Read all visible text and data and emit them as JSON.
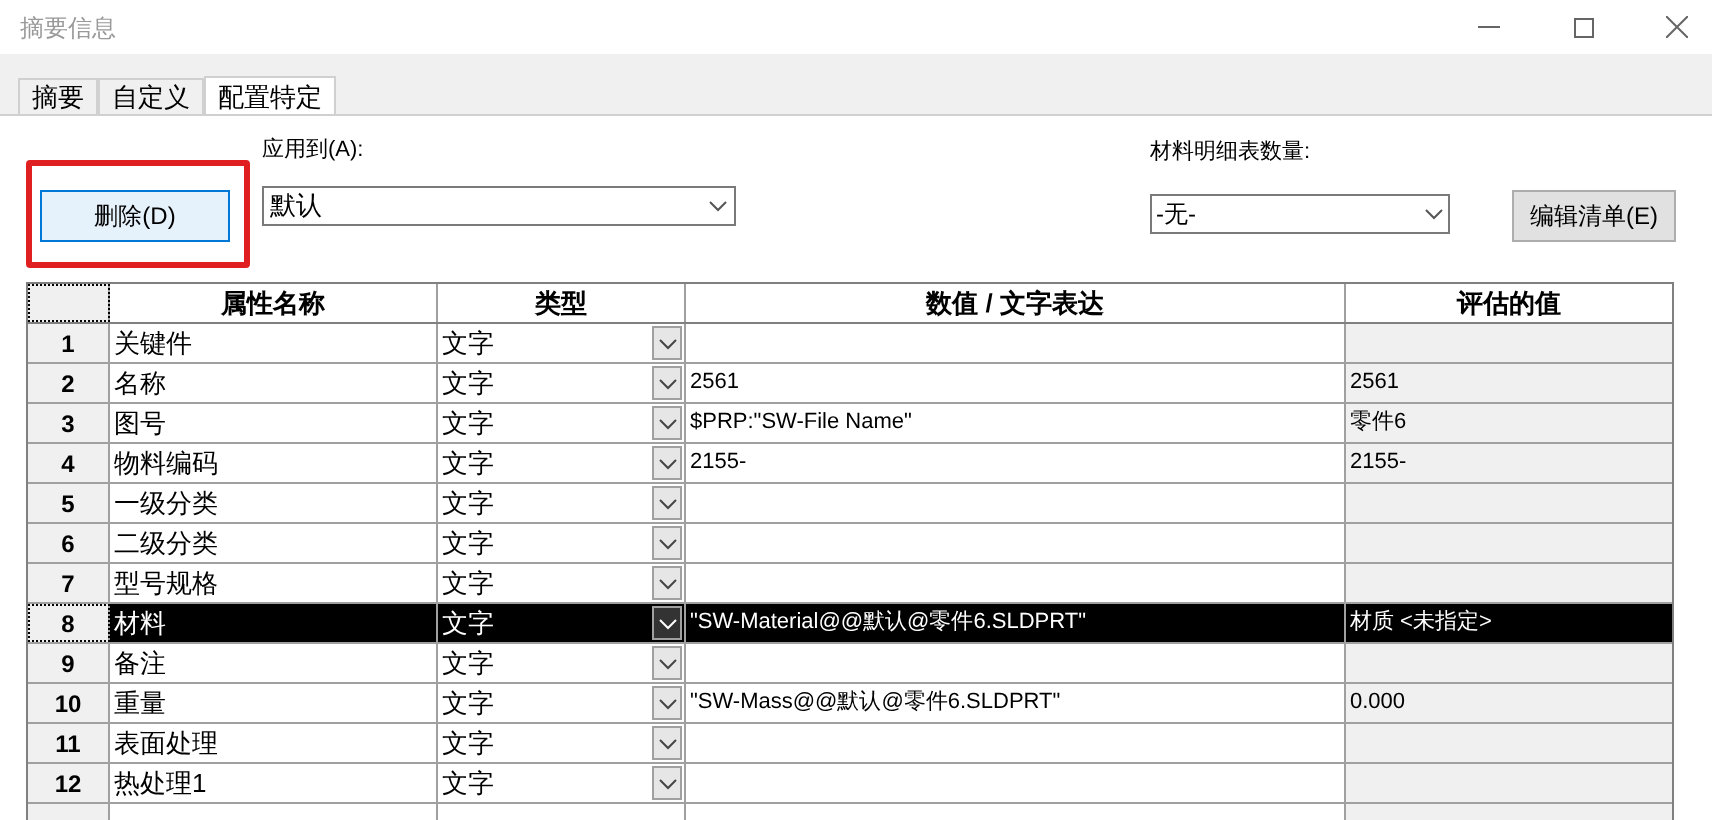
{
  "window": {
    "title": "摘要信息"
  },
  "tabs": [
    {
      "label": "摘要",
      "selected": false
    },
    {
      "label": "自定义",
      "selected": false
    },
    {
      "label": "配置特定",
      "selected": true
    }
  ],
  "delete_button": {
    "label": "删除(D)",
    "highlighted": true
  },
  "apply_to": {
    "label": "应用到(A):",
    "value": "默认"
  },
  "bom_quantity": {
    "label": "材料明细表数量:",
    "value": "-无-"
  },
  "edit_list_button": {
    "label": "编辑清单(E)"
  },
  "table": {
    "columns": [
      "属性名称",
      "类型",
      "数值 / 文字表达",
      "评估的值"
    ],
    "rows": [
      {
        "number": "1",
        "name": "关键件",
        "type": "文字",
        "value": "",
        "evaluated": "",
        "selected": false
      },
      {
        "number": "2",
        "name": "名称",
        "type": "文字",
        "value": "2561",
        "evaluated": "2561",
        "selected": false
      },
      {
        "number": "3",
        "name": "图号",
        "type": "文字",
        "value": "$PRP:\"SW-File Name\"",
        "evaluated": "零件6",
        "selected": false
      },
      {
        "number": "4",
        "name": "物料编码",
        "type": "文字",
        "value": "2155-",
        "evaluated": "2155-",
        "selected": false
      },
      {
        "number": "5",
        "name": "一级分类",
        "type": "文字",
        "value": "",
        "evaluated": "",
        "selected": false
      },
      {
        "number": "6",
        "name": "二级分类",
        "type": "文字",
        "value": "",
        "evaluated": "",
        "selected": false
      },
      {
        "number": "7",
        "name": "型号规格",
        "type": "文字",
        "value": "",
        "evaluated": "",
        "selected": false
      },
      {
        "number": "8",
        "name": "材料",
        "type": "文字",
        "value": "\"SW-Material@@默认@零件6.SLDPRT\"",
        "evaluated": "材质 <未指定>",
        "selected": true
      },
      {
        "number": "9",
        "name": "备注",
        "type": "文字",
        "value": "",
        "evaluated": "",
        "selected": false
      },
      {
        "number": "10",
        "name": "重量",
        "type": "文字",
        "value": "\"SW-Mass@@默认@零件6.SLDPRT\"",
        "evaluated": "0.000",
        "selected": false
      },
      {
        "number": "11",
        "name": "表面处理",
        "type": "文字",
        "value": "",
        "evaluated": "",
        "selected": false
      },
      {
        "number": "12",
        "name": "热处理1",
        "type": "文字",
        "value": "",
        "evaluated": "",
        "selected": false
      }
    ]
  }
}
